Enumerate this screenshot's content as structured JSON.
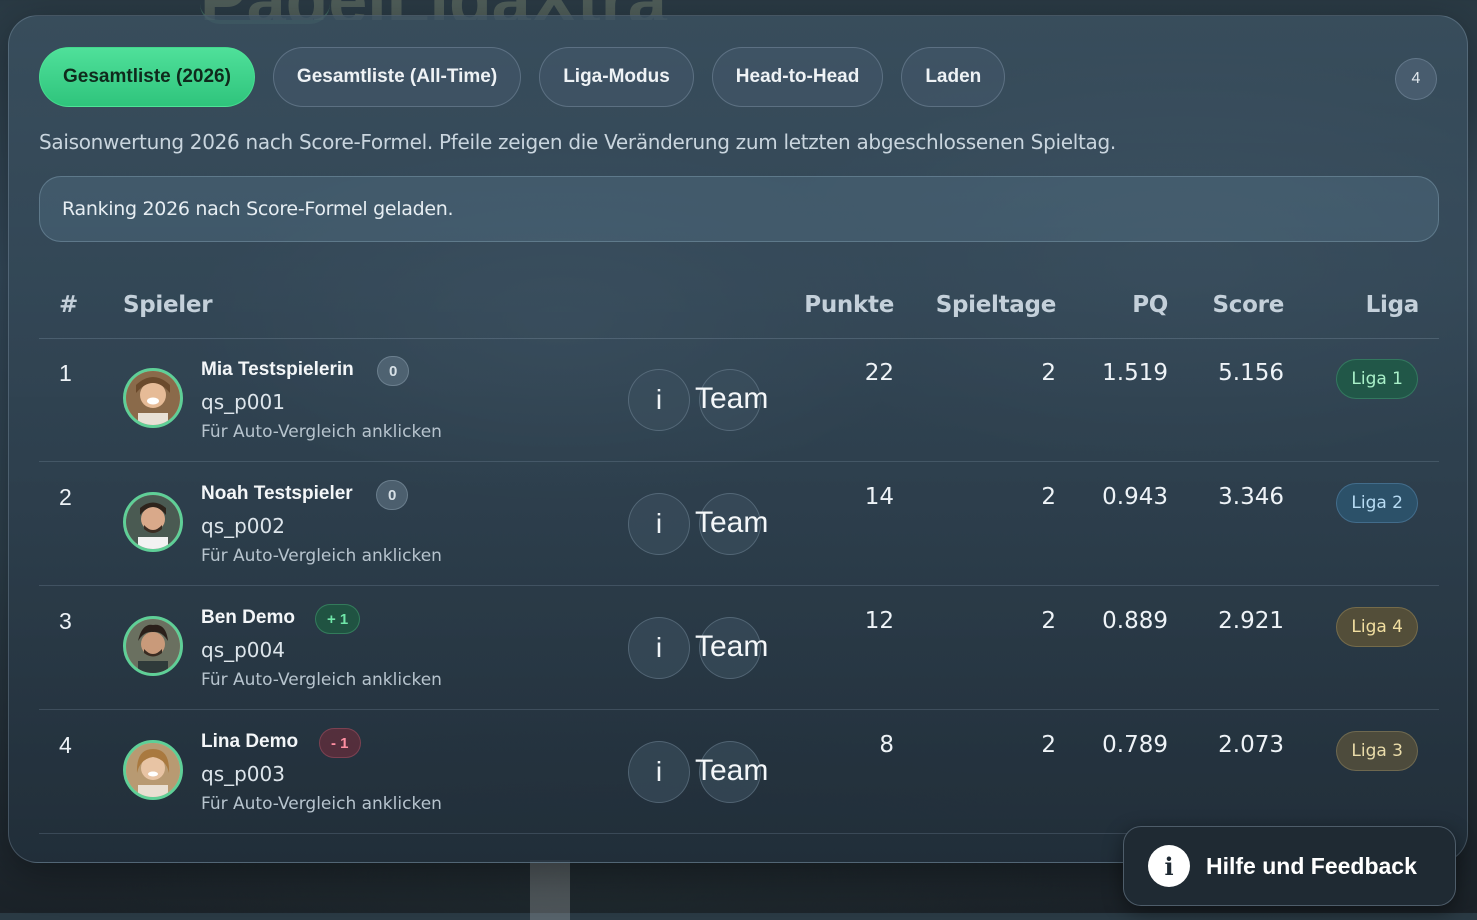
{
  "background": {
    "brand_text": "PadelLigaXtra"
  },
  "tabs": [
    {
      "label": "Gesamtliste (2026)",
      "active": true
    },
    {
      "label": "Gesamtliste (All-Time)",
      "active": false
    },
    {
      "label": "Liga-Modus",
      "active": false
    },
    {
      "label": "Head-to-Head",
      "active": false
    },
    {
      "label": "Laden",
      "active": false
    }
  ],
  "count_badge": "4",
  "subtitle": "Saisonwertung 2026 nach Score-Formel. Pfeile zeigen die Veränderung zum letzten abgeschlossenen Spieltag.",
  "status_message": "Ranking 2026 nach Score-Formel geladen.",
  "table": {
    "columns": {
      "rank": "#",
      "player": "Spieler",
      "points": "Punkte",
      "matchdays": "Spieltage",
      "pq": "PQ",
      "score": "Score",
      "league": "Liga"
    },
    "info_label": "i",
    "team_label": "Team",
    "rows": [
      {
        "rank": "1",
        "name": "Mia Testspielerin",
        "change": "0",
        "change_type": "zero",
        "id": "qs_p001",
        "hint": "Für Auto-Vergleich anklicken",
        "points": "22",
        "matchdays": "2",
        "pq": "1.519",
        "score": "5.156",
        "league": "Liga 1",
        "league_color": "#1e5a46"
      },
      {
        "rank": "2",
        "name": "Noah Testspieler",
        "change": "0",
        "change_type": "zero",
        "id": "qs_p002",
        "hint": "Für Auto-Vergleich anklicken",
        "points": "14",
        "matchdays": "2",
        "pq": "0.943",
        "score": "3.346",
        "league": "Liga 2",
        "league_color": "#2d556e"
      },
      {
        "rank": "3",
        "name": "Ben Demo",
        "change": "+ 1",
        "change_type": "up",
        "id": "qs_p004",
        "hint": "Für Auto-Vergleich anklicken",
        "points": "12",
        "matchdays": "2",
        "pq": "0.889",
        "score": "2.921",
        "league": "Liga 4",
        "league_color": "#5a5237"
      },
      {
        "rank": "4",
        "name": "Lina Demo",
        "change": "- 1",
        "change_type": "down",
        "id": "qs_p003",
        "hint": "Für Auto-Vergleich anklicken",
        "points": "8",
        "matchdays": "2",
        "pq": "0.789",
        "score": "2.073",
        "league": "Liga 3",
        "league_color": "#55503c"
      }
    ]
  },
  "help_button": {
    "label": "Hilfe und Feedback",
    "icon": "info-icon"
  },
  "colors": {
    "accent_green": "#2fc47c",
    "change_up": "#6fe6a8",
    "change_down": "#ff8fa2"
  }
}
